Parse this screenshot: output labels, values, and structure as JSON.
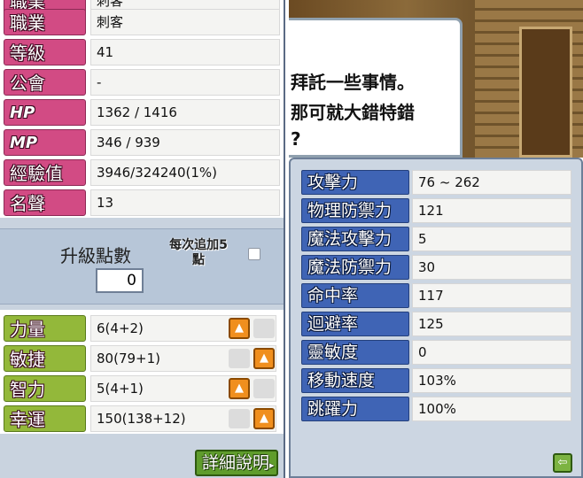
{
  "stats": {
    "rows": [
      {
        "label": "職業",
        "value": "刺客"
      },
      {
        "label": "等級",
        "value": "41"
      },
      {
        "label": "公會",
        "value": "-"
      },
      {
        "label": "HP",
        "value": "1362 / 1416"
      },
      {
        "label": "MP",
        "value": "346 / 939"
      },
      {
        "label": "經驗值",
        "value": "3946/324240(1%)"
      },
      {
        "label": "名聲",
        "value": "13"
      }
    ],
    "ap_title": "升級點數",
    "ap_value": "0",
    "auto_assign_label": "每次追加5點",
    "auto_assign_line1": "每次追加5",
    "auto_assign_line2": "點",
    "attributes": [
      {
        "label": "力量",
        "value": "6(4+2)"
      },
      {
        "label": "敏捷",
        "value": "80(79+1)"
      },
      {
        "label": "智力",
        "value": "5(4+1)"
      },
      {
        "label": "幸運",
        "value": "150(138+12)"
      }
    ],
    "detail_button": "詳細說明",
    "label_color": "#d24b84",
    "attribute_label_color": "#93b83a"
  },
  "npc_dialog": {
    "lines": [
      "拜託一些事情。",
      "那可就大錯特錯",
      "?"
    ]
  },
  "details": {
    "rows": [
      {
        "label": "攻擊力",
        "value": "76 ~ 262"
      },
      {
        "label": "物理防禦力",
        "value": "121"
      },
      {
        "label": "魔法攻擊力",
        "value": "5"
      },
      {
        "label": "魔法防禦力",
        "value": "30"
      },
      {
        "label": "命中率",
        "value": "117"
      },
      {
        "label": "迴避率",
        "value": "125"
      },
      {
        "label": "靈敏度",
        "value": "0"
      },
      {
        "label": "移動速度",
        "value": "103%"
      },
      {
        "label": "跳躍力",
        "value": "100%"
      }
    ],
    "label_color": "#3f64b5"
  },
  "icons": {
    "up_arrow": "up-arrow-icon",
    "back_arrow": "back-arrow-icon",
    "detail_arrow": "chevron-right-icon"
  }
}
